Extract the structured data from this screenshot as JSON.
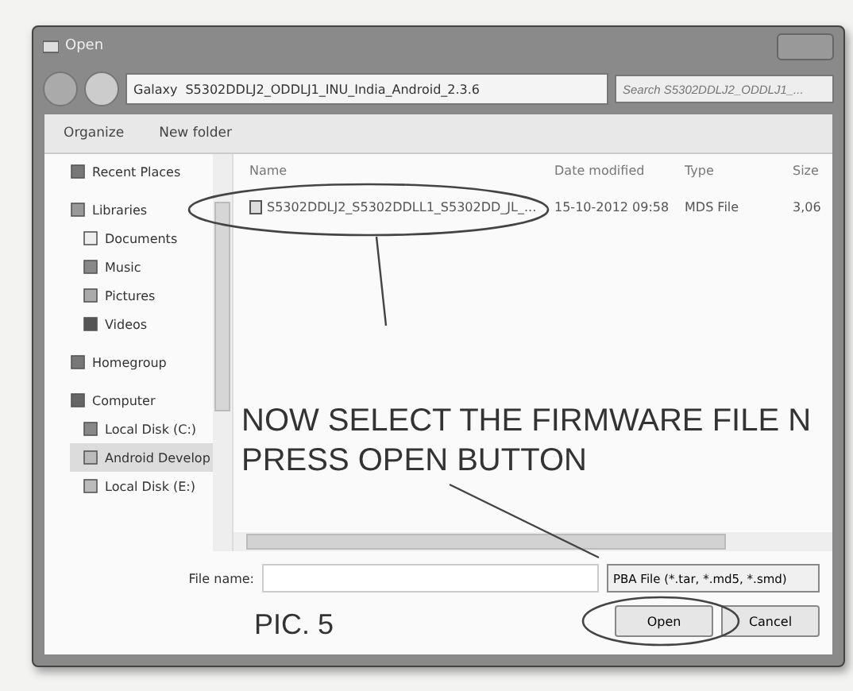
{
  "window": {
    "title": "Open"
  },
  "address": {
    "crumbs": [
      "Galaxy",
      "S5302DDLJ2_ODDLJ1_INU_India_Android_2.3.6"
    ],
    "search_placeholder": "Search S5302DDLJ2_ODDLJ1_..."
  },
  "toolbar": {
    "items": [
      "Organize",
      "New folder"
    ]
  },
  "sidebar": {
    "items": [
      {
        "label": "Recent Places",
        "kind": "item",
        "selected": false
      },
      {
        "label": "Libraries",
        "kind": "group",
        "selected": false
      },
      {
        "label": "Documents",
        "kind": "item",
        "selected": false
      },
      {
        "label": "Music",
        "kind": "item",
        "selected": false
      },
      {
        "label": "Pictures",
        "kind": "item",
        "selected": false
      },
      {
        "label": "Videos",
        "kind": "item",
        "selected": false
      },
      {
        "label": "Homegroup",
        "kind": "group",
        "selected": false
      },
      {
        "label": "Computer",
        "kind": "group",
        "selected": false
      },
      {
        "label": "Local Disk (C:)",
        "kind": "item",
        "selected": false
      },
      {
        "label": "Android Develop",
        "kind": "item",
        "selected": true
      },
      {
        "label": "Local Disk (E:)",
        "kind": "item",
        "selected": false
      }
    ]
  },
  "table": {
    "columns": [
      "Name",
      "Date modified",
      "Type",
      "Size"
    ],
    "rows": [
      {
        "cells": [
          "S5302DDLJ2_S5302DDLL1_S5302DD_JL_...",
          "15-10-2012 09:58",
          "MDS File",
          "3,06"
        ]
      }
    ]
  },
  "file_name": {
    "label": "File name:"
  },
  "file_type": {
    "value": "PBA File (*.tar, *.md5, *.smd)"
  },
  "buttons": [
    "Open",
    "Cancel"
  ],
  "annotations": {
    "instruction": [
      "NOW SELECT THE FIRMWARE FILE N",
      "PRESS OPEN BUTTON"
    ],
    "caption": "PIC. 5"
  }
}
